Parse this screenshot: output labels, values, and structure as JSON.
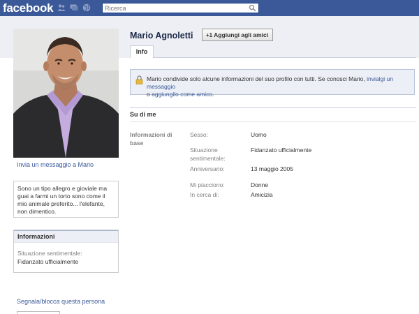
{
  "app": {
    "logo": "facebook"
  },
  "search": {
    "placeholder": "Ricerca"
  },
  "profile": {
    "name": "Mario Agnoletti",
    "add_friend_label": "Aggiungi agli amici",
    "tab_info": "Info",
    "send_message_link": "Invia un messaggio a Mario",
    "bio": "Sono un tipo allegro e gioviale ma guai a farmi un torto sono come il mio animale preferito... l'elefante, non dimentico.",
    "report_link": "Segnala/blocca questa persona"
  },
  "sidebar_info": {
    "title": "Informazioni",
    "label": "Situazione sentimentale:",
    "value": "Fidanzato ufficialmente"
  },
  "notice": {
    "text": "Mario condivide solo alcune informazioni del suo profilo con tutti. Se conosci Mario,",
    "link1": "invialgi un messaggio",
    "middle": "o",
    "link2": "aggiungilo come amico",
    "end": "."
  },
  "about": {
    "title": "Su di me",
    "group_label": "Informazioni di base",
    "fields": [
      {
        "key": "Sesso:",
        "value": "Uomo"
      },
      {
        "key": "Situazione sentimentale:",
        "value": "Fidanzato ufficialmente"
      },
      {
        "key": "Anniversario:",
        "value": "13 maggio 2005"
      },
      {
        "key": "Mi piacciono:",
        "value": "Donne"
      },
      {
        "key": "In cerca di:",
        "value": "Amicizia"
      }
    ]
  },
  "colors": {
    "brand": "#3b5998",
    "link": "#3b5998",
    "notice_bg": "#eceff5"
  }
}
